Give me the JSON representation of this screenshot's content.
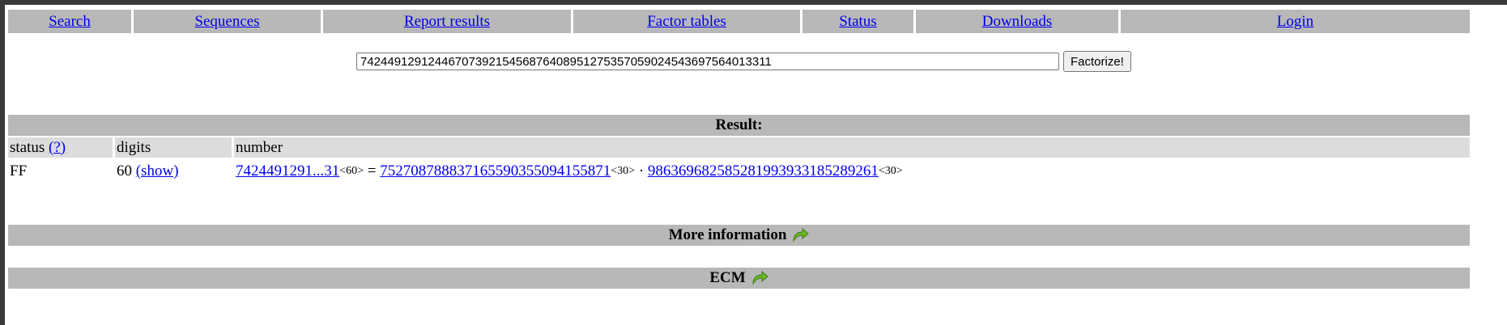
{
  "nav": {
    "items": [
      "Search",
      "Sequences",
      "Report results",
      "Factor tables",
      "Status",
      "Downloads",
      "Login"
    ]
  },
  "search": {
    "value": "7424491291244670739215456876408951275357059024543697564013311",
    "button_label": "Factorize!"
  },
  "result": {
    "heading": "Result:",
    "columns": {
      "status": "status",
      "status_help": "(?)",
      "digits": "digits",
      "number": "number"
    },
    "row": {
      "status": "FF",
      "digits": "60",
      "show": "(show)",
      "number": "7424491291...31",
      "number_digits": "<60>",
      "equals": "=",
      "factor1": "752708788837165590355094155871",
      "factor1_digits": "<30>",
      "dot": "·",
      "factor2": "986369682585281993933185289261",
      "factor2_digits": "<30>"
    }
  },
  "sections": {
    "more_info": "More information",
    "ecm": "ECM"
  },
  "icons": {
    "arrow": "green-curved-arrow-icon"
  },
  "colors": {
    "bar": "#b8b8b8",
    "subheader": "#dcdcdc",
    "link": "#0000ee",
    "arrow": "#6ab82a"
  }
}
